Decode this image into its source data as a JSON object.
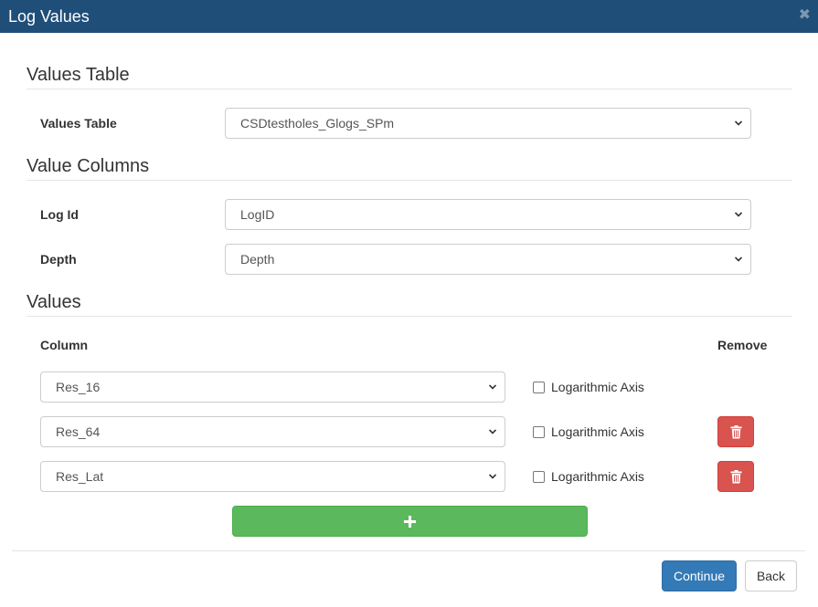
{
  "window": {
    "title": "Log Values",
    "close_glyph": "✖"
  },
  "sections": {
    "values_table": {
      "heading": "Values Table",
      "label": "Values Table",
      "selected": "CSDtestholes_Glogs_SPm"
    },
    "value_columns": {
      "heading": "Value Columns",
      "log_id": {
        "label": "Log Id",
        "selected": "LogID"
      },
      "depth": {
        "label": "Depth",
        "selected": "Depth"
      }
    },
    "values": {
      "heading": "Values",
      "column_header": "Column",
      "remove_header": "Remove",
      "rows": [
        {
          "column": "Res_16",
          "log_axis_label": "Logarithmic Axis",
          "log_axis_checked": false,
          "removable": false
        },
        {
          "column": "Res_64",
          "log_axis_label": "Logarithmic Axis",
          "log_axis_checked": false,
          "removable": true
        },
        {
          "column": "Res_Lat",
          "log_axis_label": "Logarithmic Axis",
          "log_axis_checked": false,
          "removable": true
        }
      ],
      "add_icon": "plus-icon",
      "remove_icon": "trash-icon"
    }
  },
  "footer": {
    "continue_label": "Continue",
    "back_label": "Back"
  },
  "colors": {
    "titlebar": "#1f4e79",
    "primary": "#337ab7",
    "danger": "#d9534f",
    "success": "#5cb85c"
  }
}
